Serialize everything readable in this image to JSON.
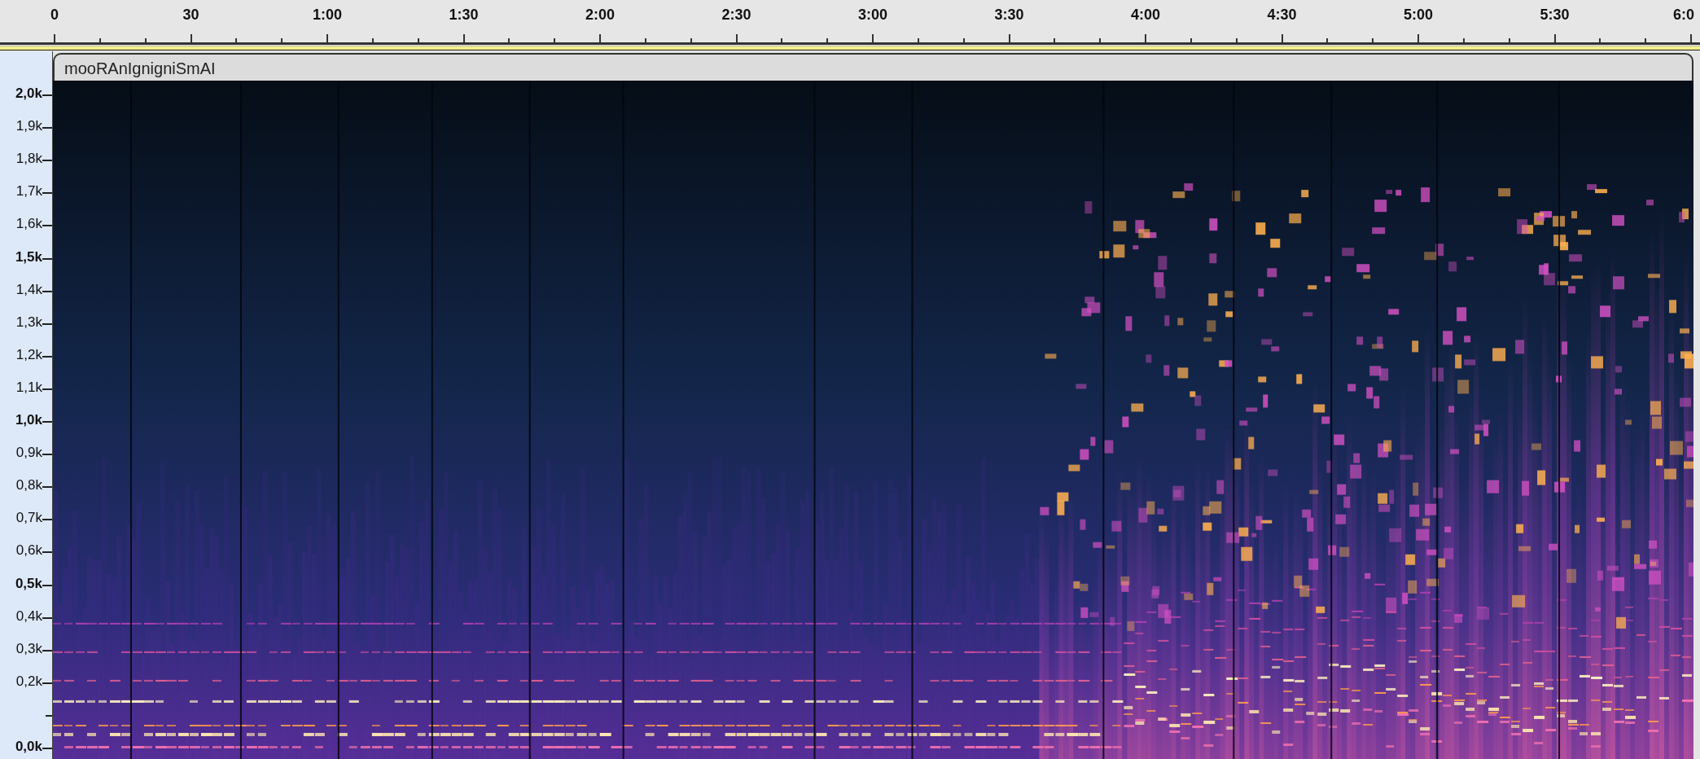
{
  "timeline": {
    "labels": [
      "0",
      "30",
      "1:00",
      "1:30",
      "2:00",
      "2:30",
      "3:00",
      "3:30",
      "4:00",
      "4:30",
      "5:00",
      "5:30",
      "6:0"
    ]
  },
  "track": {
    "name": "mooRAnIgnigniSmAI"
  },
  "frequency_axis": {
    "ticks": [
      {
        "kind": "major",
        "label": "2,0k"
      },
      {
        "kind": "minor",
        "label": "1,9k"
      },
      {
        "kind": "minor",
        "label": "1,8k"
      },
      {
        "kind": "minor",
        "label": "1,7k"
      },
      {
        "kind": "minor",
        "label": "1,6k"
      },
      {
        "kind": "major",
        "label": "1,5k"
      },
      {
        "kind": "minor",
        "label": "1,4k"
      },
      {
        "kind": "minor",
        "label": "1,3k"
      },
      {
        "kind": "minor",
        "label": "1,2k"
      },
      {
        "kind": "minor",
        "label": "1,1k"
      },
      {
        "kind": "major",
        "label": "1,0k"
      },
      {
        "kind": "minor",
        "label": "0,9k"
      },
      {
        "kind": "minor",
        "label": "0,8k"
      },
      {
        "kind": "minor",
        "label": "0,7k"
      },
      {
        "kind": "minor",
        "label": "0,6k"
      },
      {
        "kind": "major",
        "label": "0,5k"
      },
      {
        "kind": "minor",
        "label": "0,4k"
      },
      {
        "kind": "minor",
        "label": "0,3k"
      },
      {
        "kind": "minor",
        "label": "0,2k"
      },
      {
        "kind": "unlabeled"
      },
      {
        "kind": "major",
        "label": "0,0k"
      }
    ]
  }
}
